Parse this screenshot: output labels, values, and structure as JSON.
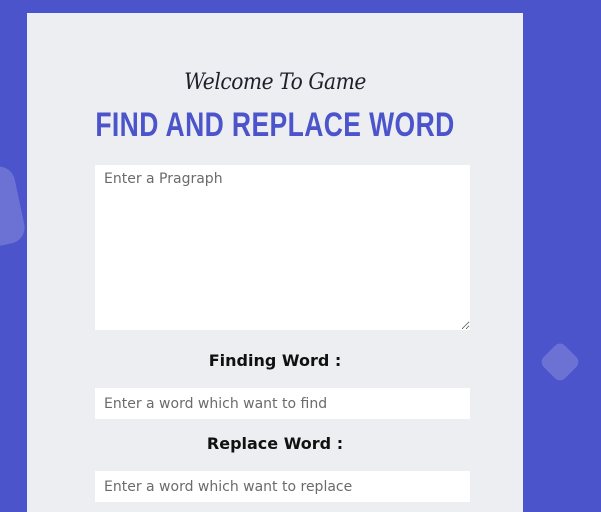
{
  "header": {
    "welcome": "Welcome To Game",
    "title": "FIND AND REPLACE WORD"
  },
  "paragraph_input": {
    "placeholder": "Enter a Pragraph",
    "value": ""
  },
  "find": {
    "label": "Finding Word :",
    "placeholder": "Enter a word which want to find",
    "value": ""
  },
  "replace": {
    "label": "Replace Word :",
    "placeholder": "Enter a word which want to replace",
    "value": ""
  },
  "colors": {
    "background": "#4c54cb",
    "card": "#edeef2",
    "title": "#4c54cb"
  }
}
